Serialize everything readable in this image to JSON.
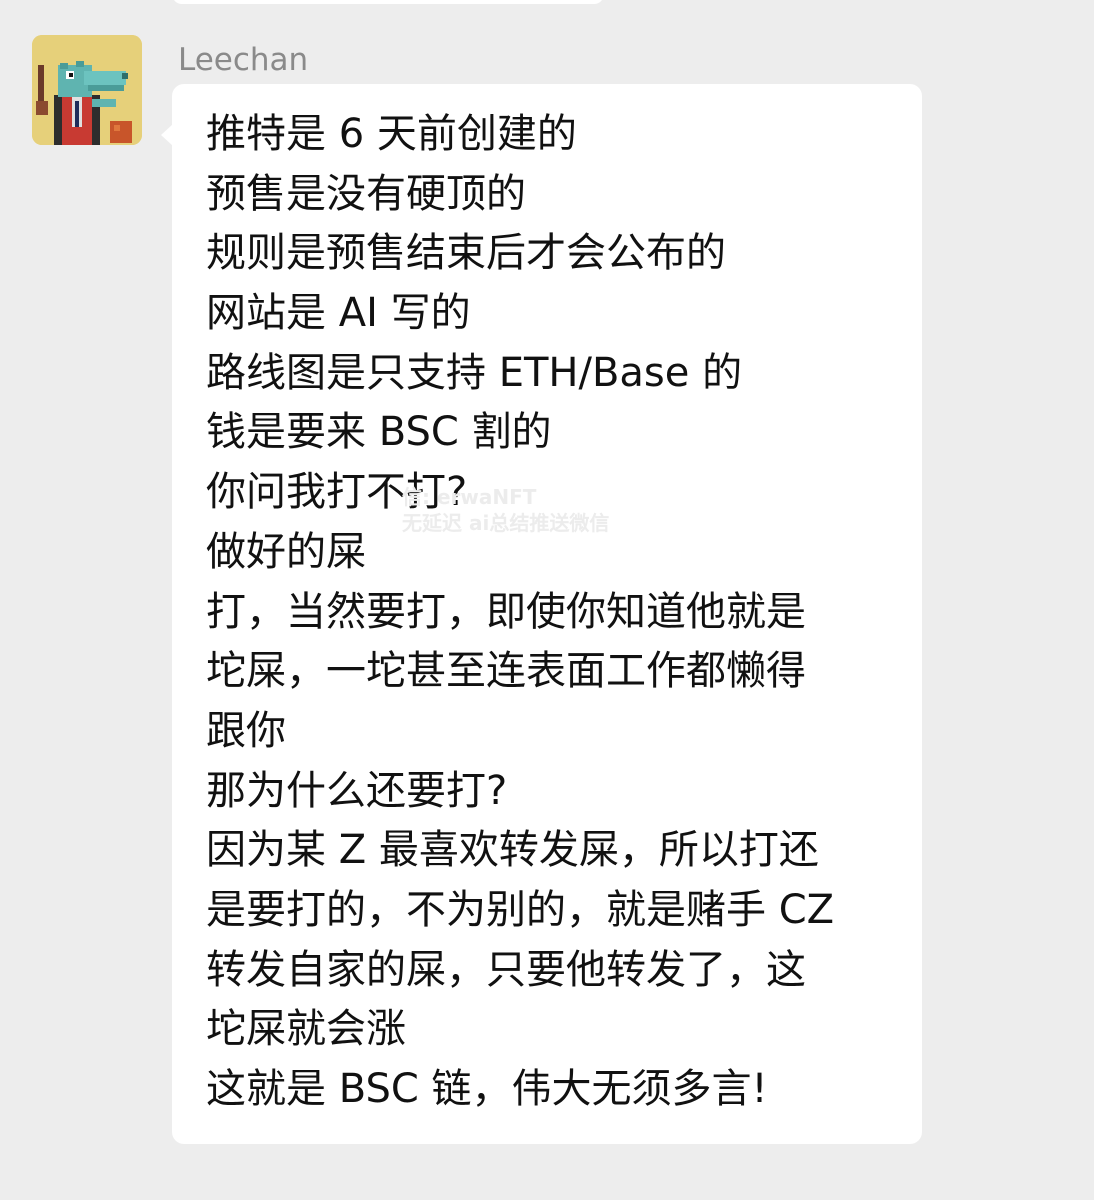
{
  "sender": {
    "name": "Leechan",
    "avatar_icon": "pixel-crocodile-avatar-icon"
  },
  "message": {
    "lines": [
      "推特是 6 天前创建的",
      "预售是没有硬顶的",
      "规则是预售结束后才会公布的",
      "网站是 AI 写的",
      "路线图是只支持 ETH/Base 的",
      "钱是要来 BSC 割的",
      "你问我打不打?",
      "做好的屎",
      "打，当然要打，即使你知道他就是",
      "坨屎，一坨甚至连表面工作都懒得",
      "跟你",
      "那为什么还要打?",
      "因为某 Z 最喜欢转发屎，所以打还",
      "是要打的，不为别的，就是赌手 CZ",
      "转发自家的屎，只要他转发了，这",
      "坨屎就会涨",
      "这就是 BSC 链，伟大无须多言!"
    ]
  },
  "watermark": {
    "line1": "信: erwaNFT",
    "line2": "无延迟 ai总结推送微信"
  },
  "colors": {
    "background": "#ededed",
    "bubble": "#ffffff",
    "text": "#111111",
    "name": "#8a8a8a"
  }
}
